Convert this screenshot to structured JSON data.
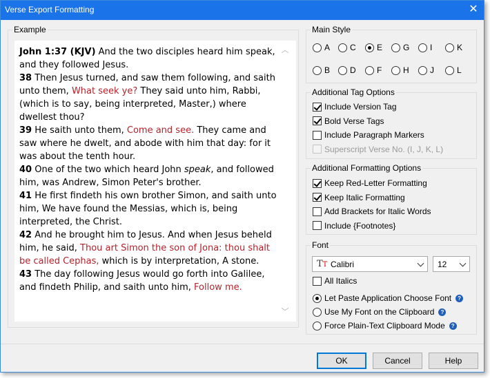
{
  "window": {
    "title": "Verse Export Formatting"
  },
  "example": {
    "label": "Example",
    "paragraphs": [
      {
        "runs": [
          {
            "t": "John 1:37 (KJV)",
            "s": "b"
          },
          {
            "t": " And the two disciples heard him speak, and they followed Jesus."
          }
        ]
      },
      {
        "runs": [
          {
            "t": "38",
            "s": "b"
          },
          {
            "t": " Then Jesus turned, and saw them following, and saith unto them, "
          },
          {
            "t": "What seek ye?",
            "s": "r"
          },
          {
            "t": " They said unto him, Rabbi, (which is to say, being interpreted, Master,) where dwellest thou?"
          }
        ]
      },
      {
        "runs": [
          {
            "t": "39",
            "s": "b"
          },
          {
            "t": " He saith unto them, "
          },
          {
            "t": "Come and see.",
            "s": "r"
          },
          {
            "t": " They came and saw where he dwelt, and abode with him that day: for it was about the tenth hour."
          }
        ]
      },
      {
        "runs": [
          {
            "t": "40",
            "s": "b"
          },
          {
            "t": " One of the two which heard John "
          },
          {
            "t": "speak",
            "s": "i"
          },
          {
            "t": ", and followed him, was Andrew, Simon Peter's brother."
          }
        ]
      },
      {
        "runs": [
          {
            "t": "41",
            "s": "b"
          },
          {
            "t": " He first findeth his own brother Simon, and saith unto him, We have found the Messias, which is, being interpreted, the Christ."
          }
        ]
      },
      {
        "runs": [
          {
            "t": "42",
            "s": "b"
          },
          {
            "t": " And he brought him to Jesus. And when Jesus beheld him, he said, "
          },
          {
            "t": "Thou art Simon the son of Jona: thou shalt be called Cephas,",
            "s": "r"
          },
          {
            "t": " which is by interpretation, A stone."
          }
        ]
      },
      {
        "runs": [
          {
            "t": "43",
            "s": "b"
          },
          {
            "t": " The day following Jesus would go forth into Galilee, and findeth Philip, and saith unto him, "
          },
          {
            "t": "Follow me.",
            "s": "r"
          }
        ]
      }
    ]
  },
  "main_style": {
    "label": "Main Style",
    "options": [
      "A",
      "C",
      "E",
      "G",
      "I",
      "K",
      "B",
      "D",
      "F",
      "H",
      "J",
      "L"
    ],
    "selected": "E"
  },
  "tag_options": {
    "label": "Additional Tag Options",
    "items": [
      {
        "label": "Include Version Tag",
        "checked": true,
        "enabled": true
      },
      {
        "label": "Bold Verse Tags",
        "checked": true,
        "enabled": true
      },
      {
        "label": "Include Paragraph Markers",
        "checked": false,
        "enabled": true
      },
      {
        "label": "Superscript Verse No. (I, J, K, L)",
        "checked": false,
        "enabled": false
      }
    ]
  },
  "format_options": {
    "label": "Additional Formatting Options",
    "items": [
      {
        "label": "Keep Red-Letter Formatting",
        "checked": true,
        "enabled": true
      },
      {
        "label": "Keep Italic Formatting",
        "checked": true,
        "enabled": true
      },
      {
        "label": "Add Brackets for Italic Words",
        "checked": false,
        "enabled": true
      },
      {
        "label": "Include {Footnotes}",
        "checked": false,
        "enabled": true
      }
    ]
  },
  "font": {
    "label": "Font",
    "family": "Calibri",
    "size": "12",
    "all_italics_label": "All Italics",
    "all_italics_checked": false,
    "paste_modes": [
      "Let Paste Application Choose Font",
      "Use My Font on the Clipboard",
      "Force Plain-Text Clipboard Mode"
    ],
    "paste_selected": 0
  },
  "buttons": {
    "ok": "OK",
    "cancel": "Cancel",
    "help": "Help"
  },
  "colors": {
    "title_bar": "#1a73e8",
    "words_of_christ": "#b5222b",
    "default_button_border": "#0078d7"
  }
}
